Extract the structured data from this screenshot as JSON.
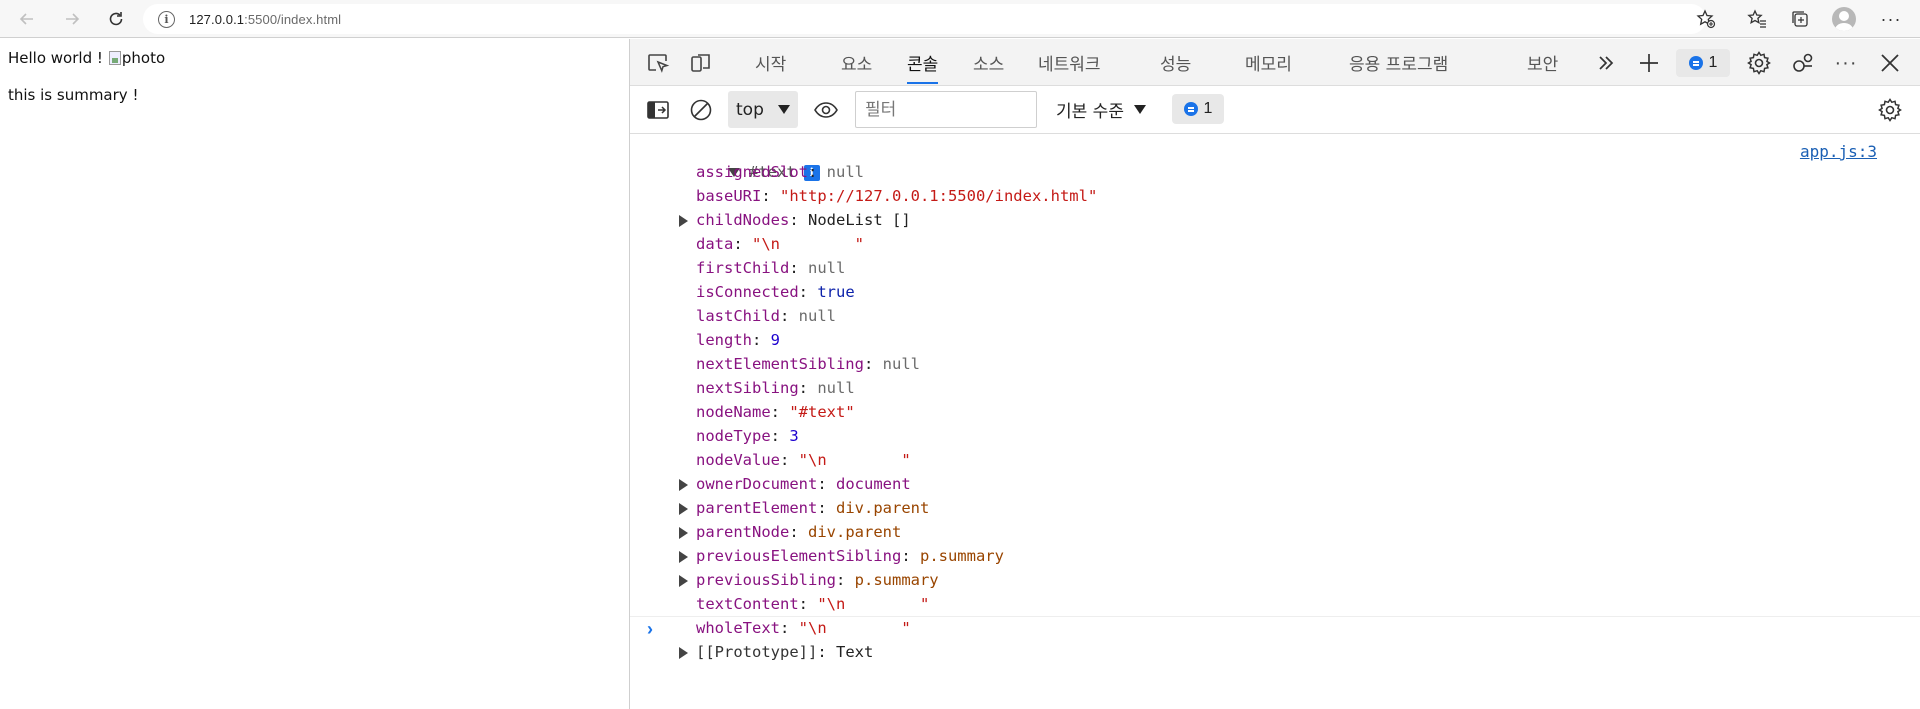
{
  "browser": {
    "url_host": "127.0.0.1",
    "url_rest": ":5500/index.html"
  },
  "page": {
    "hello_text": "Hello world !",
    "image_alt": "photo",
    "summary_text": "this is summary !"
  },
  "devtools": {
    "tabs": [
      {
        "label": "시작"
      },
      {
        "label": "요소"
      },
      {
        "label": "콘솔"
      },
      {
        "label": "소스"
      },
      {
        "label": "네트워크"
      },
      {
        "label": "성능"
      },
      {
        "label": "메모리"
      },
      {
        "label": "응용 프로그램"
      },
      {
        "label": "보안"
      }
    ],
    "active_tab": "콘솔",
    "issues_count": "1",
    "toolbar": {
      "context": "top",
      "filter_placeholder": "필터",
      "level": "기본 수준",
      "issues_count": "1"
    },
    "console": {
      "source_link": "app.js:3",
      "object_name": "#text",
      "properties": [
        {
          "key": "assignedSlot",
          "value": "null",
          "type": "null",
          "expandable": false
        },
        {
          "key": "baseURI",
          "value": "\"http://127.0.0.1:5500/index.html\"",
          "type": "str",
          "expandable": false
        },
        {
          "key": "childNodes",
          "value": "NodeList []",
          "type": "obj",
          "expandable": true
        },
        {
          "key": "data",
          "value": "\"\\n        \"",
          "type": "str",
          "expandable": false
        },
        {
          "key": "firstChild",
          "value": "null",
          "type": "null",
          "expandable": false
        },
        {
          "key": "isConnected",
          "value": "true",
          "type": "bool",
          "expandable": false
        },
        {
          "key": "lastChild",
          "value": "null",
          "type": "null",
          "expandable": false
        },
        {
          "key": "length",
          "value": "9",
          "type": "num",
          "expandable": false
        },
        {
          "key": "nextElementSibling",
          "value": "null",
          "type": "null",
          "expandable": false
        },
        {
          "key": "nextSibling",
          "value": "null",
          "type": "null",
          "expandable": false
        },
        {
          "key": "nodeName",
          "value": "\"#text\"",
          "type": "str",
          "expandable": false
        },
        {
          "key": "nodeType",
          "value": "3",
          "type": "num",
          "expandable": false
        },
        {
          "key": "nodeValue",
          "value": "\"\\n        \"",
          "type": "str",
          "expandable": false
        },
        {
          "key": "ownerDocument",
          "value": "document",
          "type": "node",
          "expandable": true
        },
        {
          "key": "parentElement",
          "value": "div.parent",
          "type": "node",
          "expandable": true
        },
        {
          "key": "parentNode",
          "value": "div.parent",
          "type": "node",
          "expandable": true
        },
        {
          "key": "previousElementSibling",
          "value": "p.summary",
          "type": "node",
          "expandable": true
        },
        {
          "key": "previousSibling",
          "value": "p.summary",
          "type": "node",
          "expandable": true
        },
        {
          "key": "textContent",
          "value": "\"\\n        \"",
          "type": "str",
          "expandable": false
        },
        {
          "key": "wholeText",
          "value": "\"\\n        \"",
          "type": "str",
          "expandable": false
        },
        {
          "key": "[[Prototype]]",
          "value": "Text",
          "type": "obj",
          "expandable": true
        }
      ]
    }
  },
  "icons": {
    "back": "arrow-left",
    "forward": "arrow-right",
    "refresh": "refresh",
    "site_info": "info-circle",
    "add_favorite": "star-plus",
    "favorites": "favorites-list",
    "collections": "collections",
    "profile": "avatar",
    "more": "ellipsis"
  },
  "colors": {
    "accent": "#1a73e8",
    "key": "#881280",
    "string": "#c41a16",
    "number": "#1c00cf",
    "null": "#6b6b6b",
    "class": "#994500"
  }
}
